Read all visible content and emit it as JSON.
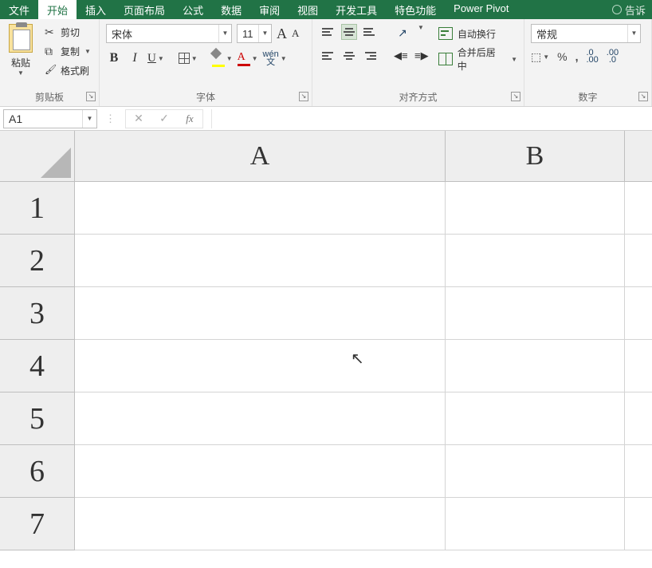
{
  "tabs": {
    "file": "文件",
    "home": "开始",
    "insert": "插入",
    "page_layout": "页面布局",
    "formulas": "公式",
    "data": "数据",
    "review": "审阅",
    "view": "视图",
    "developer": "开发工具",
    "special": "特色功能",
    "power_pivot": "Power Pivot",
    "tell_me": "告诉"
  },
  "clipboard": {
    "paste": "粘贴",
    "cut": "剪切",
    "copy": "复制",
    "format_painter": "格式刷",
    "group_label": "剪贴板"
  },
  "font": {
    "name": "宋体",
    "size": "11",
    "group_label": "字体",
    "bold": "B",
    "italic": "I",
    "underline": "U",
    "phonetic_top": "wén",
    "phonetic_bottom": "文",
    "grow": "A",
    "shrink": "A",
    "color_letter": "A"
  },
  "align": {
    "wrap": "自动换行",
    "merge": "合并后居中",
    "group_label": "对齐方式"
  },
  "number": {
    "format": "常规",
    "group_label": "数字",
    "percent": "%",
    "comma": ",",
    "dec_inc": ".0\n.00",
    "dec_dec": ".00\n .0"
  },
  "namebox": {
    "value": "A1"
  },
  "fx": {
    "cancel": "✕",
    "enter": "✓",
    "label": "fx"
  },
  "formula": "",
  "columns": {
    "A": "A",
    "B": "B"
  },
  "row_labels": [
    "1",
    "2",
    "3",
    "4",
    "5",
    "6",
    "7"
  ],
  "cells": {
    "A1": "",
    "B1": "",
    "A2": "",
    "B2": "",
    "A3": "",
    "B3": "",
    "A4": "",
    "B4": "",
    "A5": "",
    "B5": "",
    "A6": "",
    "B6": "",
    "A7": "",
    "B7": ""
  }
}
